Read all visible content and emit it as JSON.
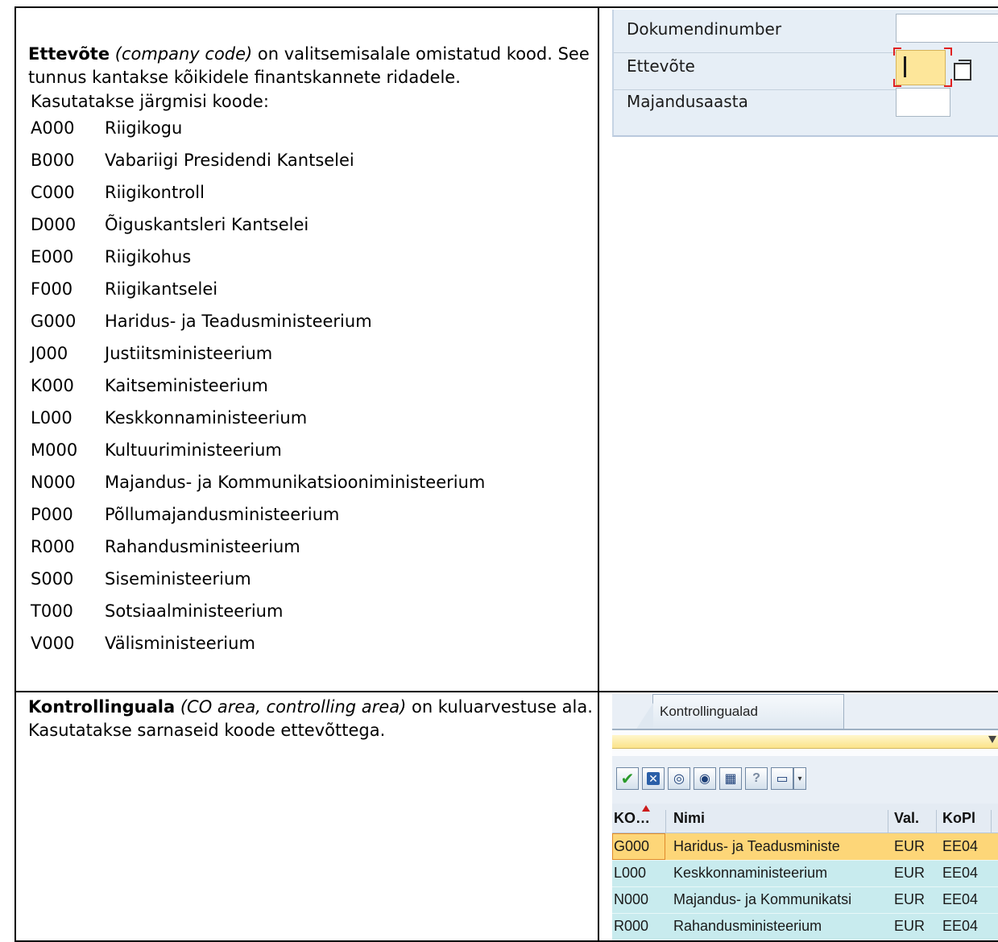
{
  "cell1": {
    "term": "Ettevõte",
    "term_en": "(company code)",
    "definition": " on valitsemisalale omistatud kood. See tunnus kantakse kõikidele finantskannete ridadele.",
    "codes_intro": "Kasutatakse järgmisi koode:",
    "codes": [
      {
        "code": "A000",
        "name": "Riigikogu"
      },
      {
        "code": "B000",
        "name": "Vabariigi Presidendi Kantselei"
      },
      {
        "code": "C000",
        "name": "Riigikontroll"
      },
      {
        "code": "D000",
        "name": "Õiguskantsleri Kantselei"
      },
      {
        "code": "E000",
        "name": "Riigikohus"
      },
      {
        "code": "F000",
        "name": "Riigikantselei"
      },
      {
        "code": "G000",
        "name": "Haridus- ja Teadusministeerium"
      },
      {
        "code": "J000",
        "name": "Justiitsministeerium"
      },
      {
        "code": "K000",
        "name": "Kaitseministeerium"
      },
      {
        "code": "L000",
        "name": "Keskkonnaministeerium"
      },
      {
        "code": "M000",
        "name": "Kultuuriministeerium"
      },
      {
        "code": "N000",
        "name": "Majandus- ja Kommunikatsiooniministeerium"
      },
      {
        "code": "P000",
        "name": "Põllumajandusministeerium"
      },
      {
        "code": "R000",
        "name": "Rahandusministeerium"
      },
      {
        "code": "S000",
        "name": "Siseministeerium"
      },
      {
        "code": "T000",
        "name": "Sotsiaalministeerium"
      },
      {
        "code": "V000",
        "name": "Välisministeerium"
      }
    ]
  },
  "cell2": {
    "term": "Kontrollinguala",
    "term_en": "(CO area, controlling area)",
    "definition": " on kuluarvestuse ala.  Kasutatakse sarnaseid koode ettevõttega."
  },
  "sap_form": {
    "fields": [
      {
        "label": "Dokumendinumber",
        "value": ""
      },
      {
        "label": "Ettevõte",
        "value": ""
      },
      {
        "label": "Majandusaasta",
        "value": ""
      }
    ]
  },
  "sap_list": {
    "tab_label": "Kontrollingualad",
    "toolbar_icons": [
      "check-icon",
      "cancel-icon",
      "find-icon",
      "find-next-icon",
      "filter-icon",
      "info-icon",
      "print-icon"
    ],
    "columns": [
      "KO…",
      "Nimi",
      "Val.",
      "KoPl"
    ],
    "rows": [
      {
        "code": "G000",
        "name": "Haridus- ja Teadusministe",
        "currency": "EUR",
        "chart": "EE04"
      },
      {
        "code": "L000",
        "name": "Keskkonnaministeerium",
        "currency": "EUR",
        "chart": "EE04"
      },
      {
        "code": "N000",
        "name": "Majandus- ja Kommunikatsi",
        "currency": "EUR",
        "chart": "EE04"
      },
      {
        "code": "R000",
        "name": "Rahandusministeerium",
        "currency": "EUR",
        "chart": "EE04"
      }
    ],
    "colors": {
      "selected_row": "#fdd678",
      "normal_row": "#c8ebee"
    }
  }
}
